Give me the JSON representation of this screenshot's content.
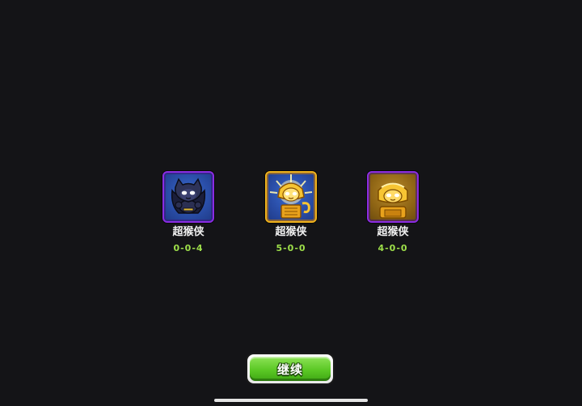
{
  "rewards": [
    {
      "name": "超猴侠",
      "path": "0-0-4",
      "frame_color": "#8a2be2",
      "icon": "dark-knight-monkey-icon"
    },
    {
      "name": "超猴侠",
      "path": "5-0-0",
      "frame_color": "#f0b21a",
      "icon": "golden-sun-god-monkey-icon"
    },
    {
      "name": "超猴侠",
      "path": "4-0-0",
      "frame_color": "#8a2be2",
      "icon": "sun-temple-monkey-icon"
    }
  ],
  "continue_label": "继续",
  "accent_green": "#5bc825",
  "path_text_color": "#9ee04a"
}
